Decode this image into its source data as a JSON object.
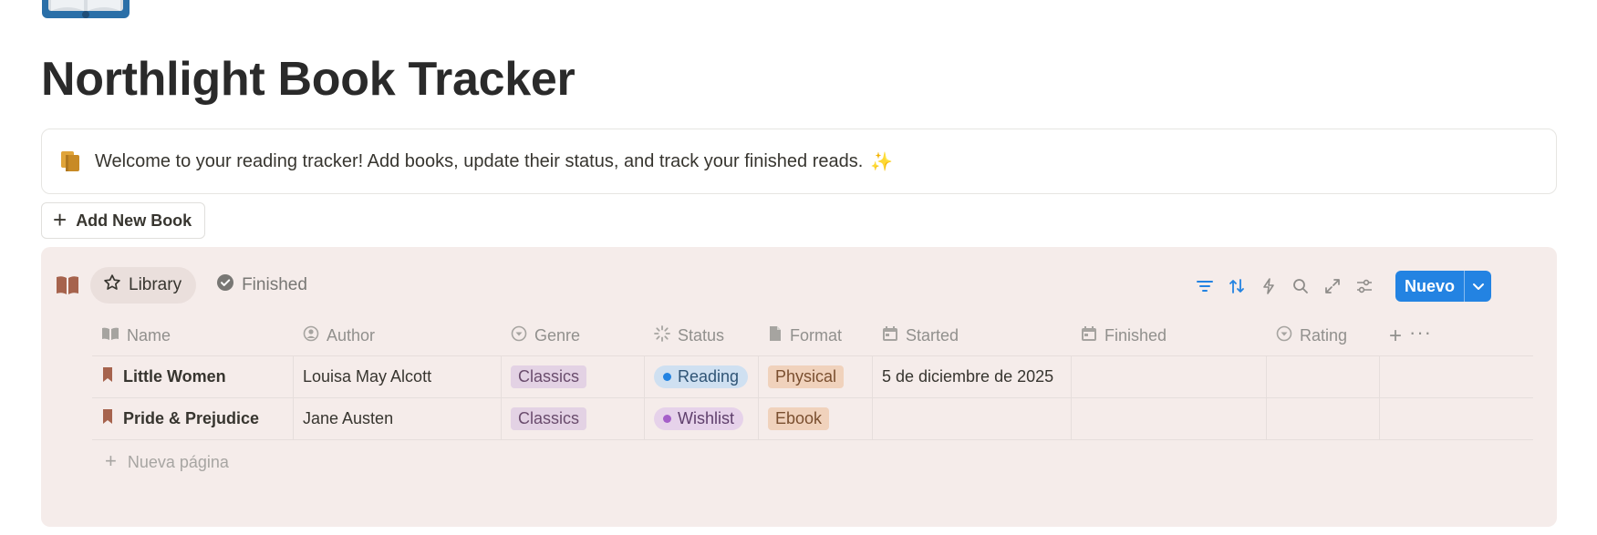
{
  "page": {
    "title": "Northlight Book Tracker"
  },
  "callout": {
    "icon": "books-icon",
    "text": "Welcome to your reading tracker! Add books, update their status, and track your finished reads.",
    "emoji": "✨"
  },
  "add_button": {
    "label": "Add New Book"
  },
  "database": {
    "tabs": [
      {
        "label": "Library",
        "icon": "star-icon",
        "active": true
      },
      {
        "label": "Finished",
        "icon": "check-circle-icon",
        "active": false
      }
    ],
    "new_button": {
      "label": "Nuevo"
    },
    "columns": [
      {
        "label": "Name",
        "icon": "book-icon"
      },
      {
        "label": "Author",
        "icon": "person-icon"
      },
      {
        "label": "Genre",
        "icon": "select-icon"
      },
      {
        "label": "Status",
        "icon": "status-icon"
      },
      {
        "label": "Format",
        "icon": "file-icon"
      },
      {
        "label": "Started",
        "icon": "calendar-icon"
      },
      {
        "label": "Finished",
        "icon": "calendar-icon"
      },
      {
        "label": "Rating",
        "icon": "select-icon"
      }
    ],
    "rows": [
      {
        "name": "Little Women",
        "author": "Louisa May Alcott",
        "genre": "Classics",
        "status": "Reading",
        "format": "Physical",
        "started": "5 de diciembre de 2025",
        "finished": "",
        "rating": ""
      },
      {
        "name": "Pride & Prejudice",
        "author": "Jane Austen",
        "genre": "Classics",
        "status": "Wishlist",
        "format": "Ebook",
        "started": "",
        "finished": "",
        "rating": ""
      }
    ],
    "new_page_label": "Nueva página"
  },
  "colors": {
    "accent": "#2383e2",
    "db_background": "#f5ecea",
    "status_reading_bg": "#cfe0f1",
    "status_reading_dot": "#2383e2",
    "status_wishlist_bg": "#e6d2ea",
    "status_wishlist_dot": "#a55fc9",
    "bookmark": "#a6634d"
  }
}
